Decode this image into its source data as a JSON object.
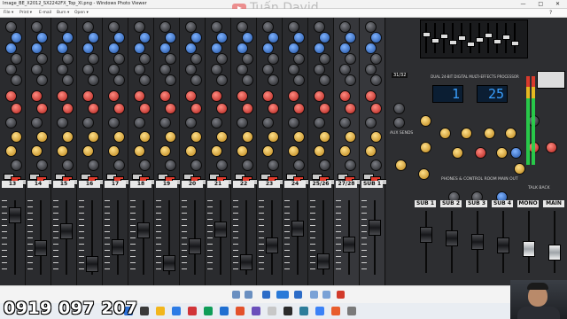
{
  "window": {
    "title": "Image_BE_X2012_SX2242FX_Top_Xl.png - Windows Photo Viewer",
    "controls": [
      "—",
      "□",
      "✕"
    ]
  },
  "menu": {
    "items": [
      "File ▾",
      "Print ▾",
      "E-mail",
      "Burn ▾",
      "Open ▾"
    ]
  },
  "watermark": {
    "text": "Tuấn David"
  },
  "mixer": {
    "channel_numbers": [
      "13",
      "14",
      "15",
      "16",
      "17",
      "18",
      "19",
      "20",
      "21",
      "22",
      "23",
      "24",
      "25/26",
      "27/28",
      "SUB 1",
      "SUB 2",
      "SUB 3",
      "SUB 4",
      "MONO",
      "MAIN"
    ],
    "fx_display": {
      "left": "1",
      "right": "25"
    },
    "fx_title": "DUAL 24-BIT DIGITAL MULTI-EFFECTS PROCESSOR",
    "section_labels": {
      "aux_sends": "AUX SENDS",
      "phones": "PHONES & CONTROL ROOM",
      "mains_out": "MAIN OUT",
      "talkback": "TALK BACK",
      "page": "31/32"
    }
  },
  "overlay": {
    "phone_number": "0919 097 207"
  },
  "taskbar": {
    "time": "",
    "date": ""
  },
  "colors": {
    "accent_blue": "#3aa0ff",
    "knob_red": "#b0201a",
    "knob_blue": "#1f4f9e",
    "knob_gold": "#b98115"
  }
}
